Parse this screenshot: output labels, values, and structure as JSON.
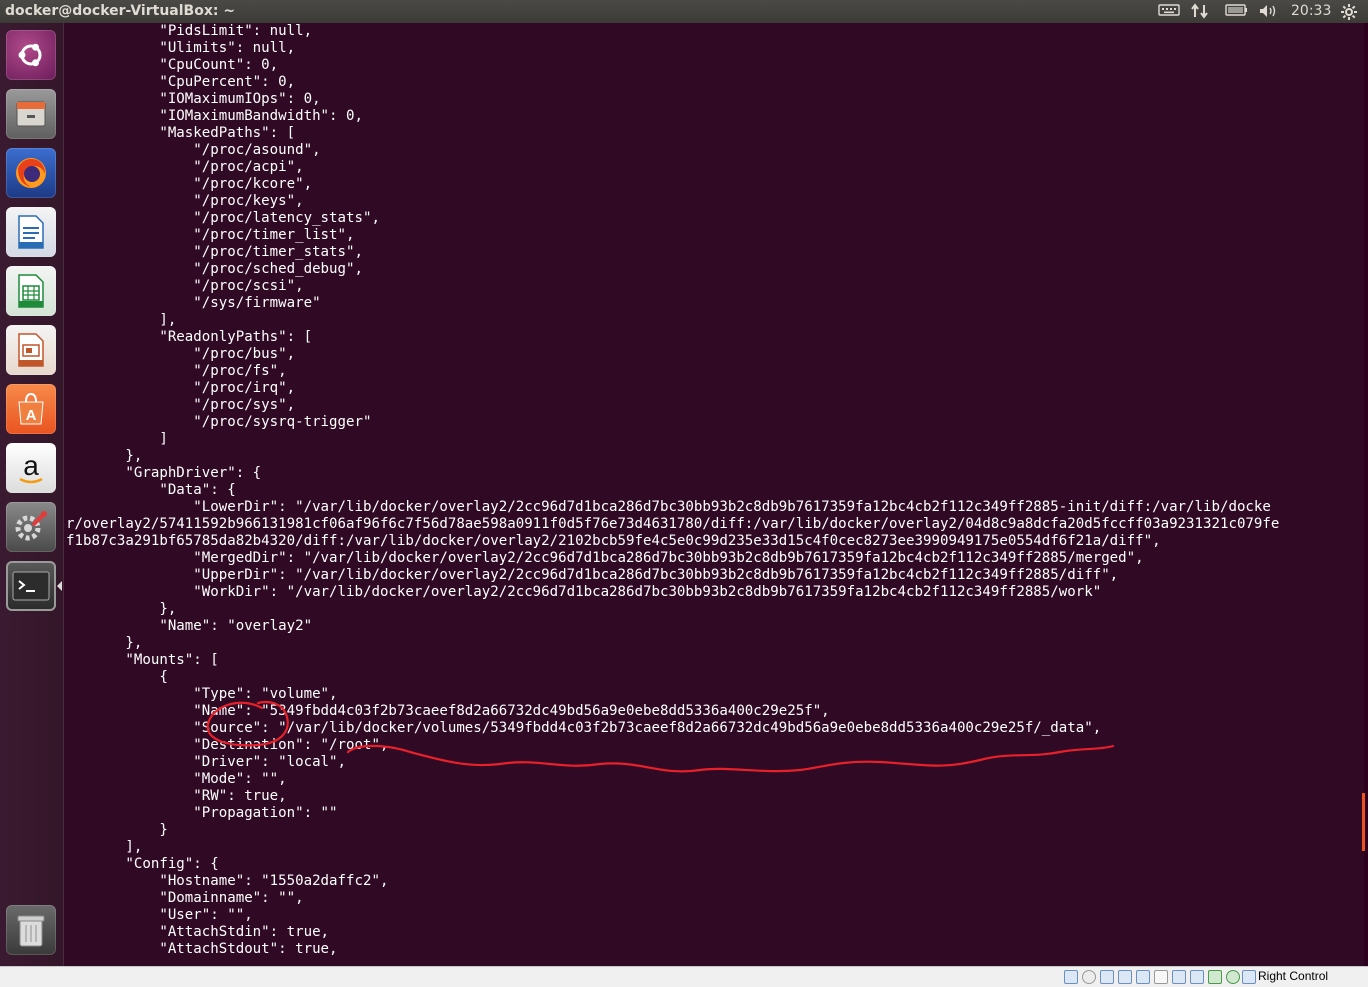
{
  "window": {
    "title": "docker@docker-VirtualBox: ~",
    "clock": "20:33"
  },
  "indicators": {
    "keyboard": "keyboard-icon",
    "network": "network-updown-icon",
    "battery": "battery-icon",
    "volume": "volume-icon",
    "settings": "gear-icon"
  },
  "launcher": {
    "items": [
      {
        "name": "ubuntu-dash",
        "icon": "ubuntu-logo-icon",
        "color": "#8a2a6a"
      },
      {
        "name": "files",
        "icon": "file-cabinet-icon",
        "color": "#7a7a7a"
      },
      {
        "name": "firefox",
        "icon": "firefox-icon",
        "color": "#e66000"
      },
      {
        "name": "libreoffice-writer",
        "icon": "document-icon",
        "color": "#2a6db5"
      },
      {
        "name": "libreoffice-calc",
        "icon": "spreadsheet-icon",
        "color": "#1e8a3a"
      },
      {
        "name": "libreoffice-impress",
        "icon": "presentation-icon",
        "color": "#c0562a"
      },
      {
        "name": "ubuntu-software",
        "icon": "shopping-bag-icon",
        "color": "#e95420"
      },
      {
        "name": "amazon",
        "icon": "amazon-icon",
        "color": "#f3f3f3"
      },
      {
        "name": "system-settings",
        "icon": "settings-wrench-icon",
        "color": "#6a6a6a"
      },
      {
        "name": "terminal",
        "icon": "terminal-icon",
        "color": "#2a2a2a"
      },
      {
        "name": "trash",
        "icon": "trash-icon",
        "color": "#9a9a9a"
      }
    ]
  },
  "terminal": {
    "lines": [
      "           \"PidsLimit\": null,",
      "           \"Ulimits\": null,",
      "           \"CpuCount\": 0,",
      "           \"CpuPercent\": 0,",
      "           \"IOMaximumIOps\": 0,",
      "           \"IOMaximumBandwidth\": 0,",
      "           \"MaskedPaths\": [",
      "               \"/proc/asound\",",
      "               \"/proc/acpi\",",
      "               \"/proc/kcore\",",
      "               \"/proc/keys\",",
      "               \"/proc/latency_stats\",",
      "               \"/proc/timer_list\",",
      "               \"/proc/timer_stats\",",
      "               \"/proc/sched_debug\",",
      "               \"/proc/scsi\",",
      "               \"/sys/firmware\"",
      "           ],",
      "           \"ReadonlyPaths\": [",
      "               \"/proc/bus\",",
      "               \"/proc/fs\",",
      "               \"/proc/irq\",",
      "               \"/proc/sys\",",
      "               \"/proc/sysrq-trigger\"",
      "           ]",
      "       },",
      "       \"GraphDriver\": {",
      "           \"Data\": {",
      "               \"LowerDir\": \"/var/lib/docker/overlay2/2cc96d7d1bca286d7bc30bb93b2c8db9b7617359fa12bc4cb2f112c349ff2885-init/diff:/var/lib/docke",
      "r/overlay2/57411592b966131981cf06af96f6c7f56d78ae598a0911f0d5f76e73d4631780/diff:/var/lib/docker/overlay2/04d8c9a8dcfa20d5fccff03a9231321c079fe",
      "f1b87c3a291bf65785da82b4320/diff:/var/lib/docker/overlay2/2102bcb59fe4c5e0c99d235e33d15c4f0cec8273ee3990949175e0554df6f21a/diff\",",
      "               \"MergedDir\": \"/var/lib/docker/overlay2/2cc96d7d1bca286d7bc30bb93b2c8db9b7617359fa12bc4cb2f112c349ff2885/merged\",",
      "               \"UpperDir\": \"/var/lib/docker/overlay2/2cc96d7d1bca286d7bc30bb93b2c8db9b7617359fa12bc4cb2f112c349ff2885/diff\",",
      "               \"WorkDir\": \"/var/lib/docker/overlay2/2cc96d7d1bca286d7bc30bb93b2c8db9b7617359fa12bc4cb2f112c349ff2885/work\"",
      "           },",
      "           \"Name\": \"overlay2\"",
      "       },",
      "       \"Mounts\": [",
      "           {",
      "               \"Type\": \"volume\",",
      "               \"Name\": \"5349fbdd4c03f2b73caeef8d2a66732dc49bd56a9e0ebe8dd5336a400c29e25f\",",
      "               \"Source\": \"/var/lib/docker/volumes/5349fbdd4c03f2b73caeef8d2a66732dc49bd56a9e0ebe8dd5336a400c29e25f/_data\",",
      "               \"Destination\": \"/root\",",
      "               \"Driver\": \"local\",",
      "               \"Mode\": \"\",",
      "               \"RW\": true,",
      "               \"Propagation\": \"\"",
      "           }",
      "       ],",
      "       \"Config\": {",
      "           \"Hostname\": \"1550a2daffc2\",",
      "           \"Domainname\": \"\",",
      "           \"User\": \"\",",
      "           \"AttachStdin\": true,",
      "           \"AttachStdout\": true,"
    ]
  },
  "statusbar": {
    "host_key": "Right Control",
    "icons": [
      "hard-disk-icon",
      "optical-drive-icon",
      "audio-icon",
      "network-icon",
      "usb-icon",
      "shared-folder-icon",
      "display-icon",
      "video-capture-icon",
      "cpu-icon",
      "mouse-integration-icon",
      "keyboard-capture-icon"
    ]
  },
  "annotation_color": "#e8202a"
}
